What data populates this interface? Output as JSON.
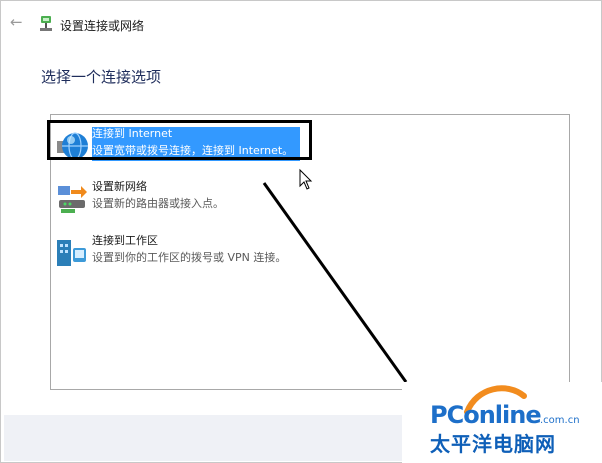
{
  "window": {
    "title": "设置连接或网络"
  },
  "heading": "选择一个连接选项",
  "options": [
    {
      "name": "连接到 Internet",
      "description": "设置宽带或拨号连接，连接到 Internet。",
      "icon": "globe-icon",
      "selected": true
    },
    {
      "name": "设置新网络",
      "description": "设置新的路由器或接入点。",
      "icon": "router-icon",
      "selected": false
    },
    {
      "name": "连接到工作区",
      "description": "设置到你的工作区的拨号或 VPN 连接。",
      "icon": "workplace-icon",
      "selected": false
    }
  ],
  "watermark": {
    "logo": "PConline",
    "domain": ".com.cn",
    "name": "太平洋电脑网"
  },
  "colors": {
    "selection": "#3399ff",
    "heading": "#1f2d5c",
    "brand": "#1d6fc9"
  }
}
